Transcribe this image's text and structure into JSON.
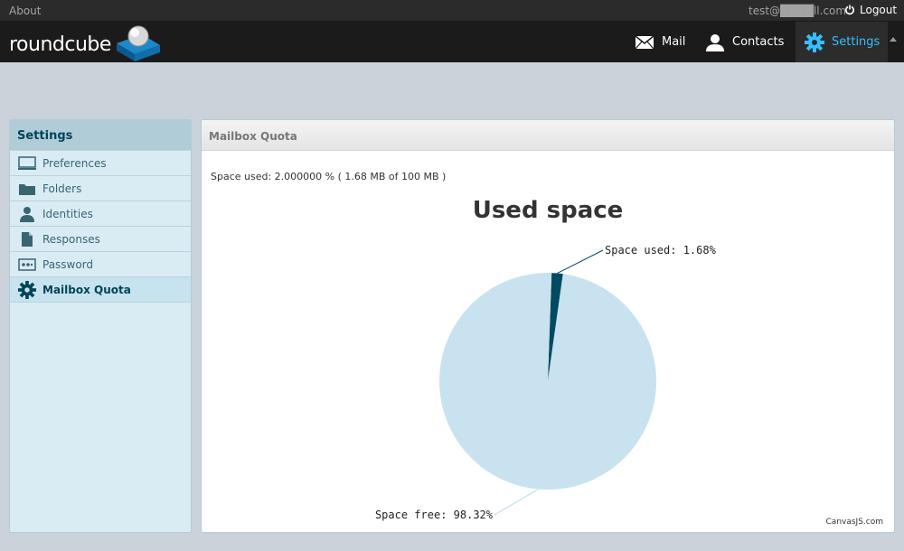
{
  "topbar": {
    "about": "About",
    "user": "test@████ll.com",
    "logout": "Logout"
  },
  "header": {
    "logo_text": "roundcube",
    "nav": {
      "mail": "Mail",
      "contacts": "Contacts",
      "settings": "Settings"
    }
  },
  "sidebar": {
    "title": "Settings",
    "items": [
      {
        "label": "Preferences",
        "icon": "monitor-icon"
      },
      {
        "label": "Folders",
        "icon": "folder-icon"
      },
      {
        "label": "Identities",
        "icon": "person-icon"
      },
      {
        "label": "Responses",
        "icon": "document-icon"
      },
      {
        "label": "Password",
        "icon": "password-icon"
      },
      {
        "label": "Mailbox Quota",
        "icon": "gear-icon"
      }
    ]
  },
  "main": {
    "title": "Mailbox Quota",
    "quota_text": "Space used: 2.000000 % ( 1.68 MB of 100 MB )"
  },
  "chart_data": {
    "type": "pie",
    "title": "Used space",
    "slices": [
      {
        "label": "Space used",
        "value": 1.68,
        "display": "1.68%",
        "color": "#004b63"
      },
      {
        "label": "Space free",
        "value": 98.32,
        "display": "98.32%",
        "color": "#c8e2ef"
      }
    ],
    "credit": "CanvasJS.com"
  },
  "colors": {
    "accent": "#37beff",
    "header_bg": "#1b1b1b",
    "sidebar_bg": "#d9ecf4"
  }
}
